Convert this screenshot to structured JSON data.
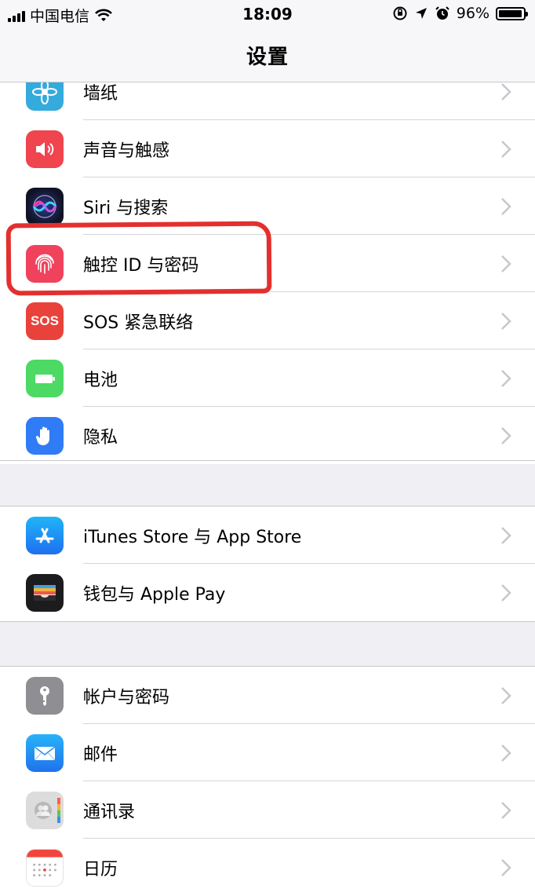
{
  "status_bar": {
    "carrier": "中国电信",
    "time": "18:09",
    "battery": "96%",
    "battery_level": 0.96
  },
  "nav": {
    "title": "设置"
  },
  "groups": [
    {
      "items": [
        {
          "label": "墙纸",
          "icon": "wallpaper-icon"
        },
        {
          "label": "声音与触感",
          "icon": "sound-icon"
        },
        {
          "label": "Siri 与搜索",
          "icon": "siri-icon"
        },
        {
          "label": "触控 ID 与密码",
          "icon": "touch-id-icon"
        },
        {
          "label": "SOS 紧急联络",
          "icon": "sos-icon",
          "icon_text": "SOS"
        },
        {
          "label": "电池",
          "icon": "battery-icon"
        },
        {
          "label": "隐私",
          "icon": "privacy-hand-icon"
        }
      ]
    },
    {
      "items": [
        {
          "label": "iTunes Store 与 App Store",
          "icon": "app-store-icon"
        },
        {
          "label": "钱包与 Apple Pay",
          "icon": "wallet-icon"
        }
      ]
    },
    {
      "items": [
        {
          "label": "帐户与密码",
          "icon": "key-icon"
        },
        {
          "label": "邮件",
          "icon": "mail-icon"
        },
        {
          "label": "通讯录",
          "icon": "contacts-icon"
        },
        {
          "label": "日历",
          "icon": "calendar-icon"
        }
      ]
    }
  ],
  "colors": {
    "highlight": "#e3302f",
    "wallpaper": "#35aadc",
    "sound": "#f0444e",
    "touch_id": "#f0425d",
    "sos": "#e8423b",
    "battery": "#4cd964",
    "privacy": "#2f7cf6",
    "app_store": "#1f8ef1",
    "mail": "#2f8ef0"
  }
}
